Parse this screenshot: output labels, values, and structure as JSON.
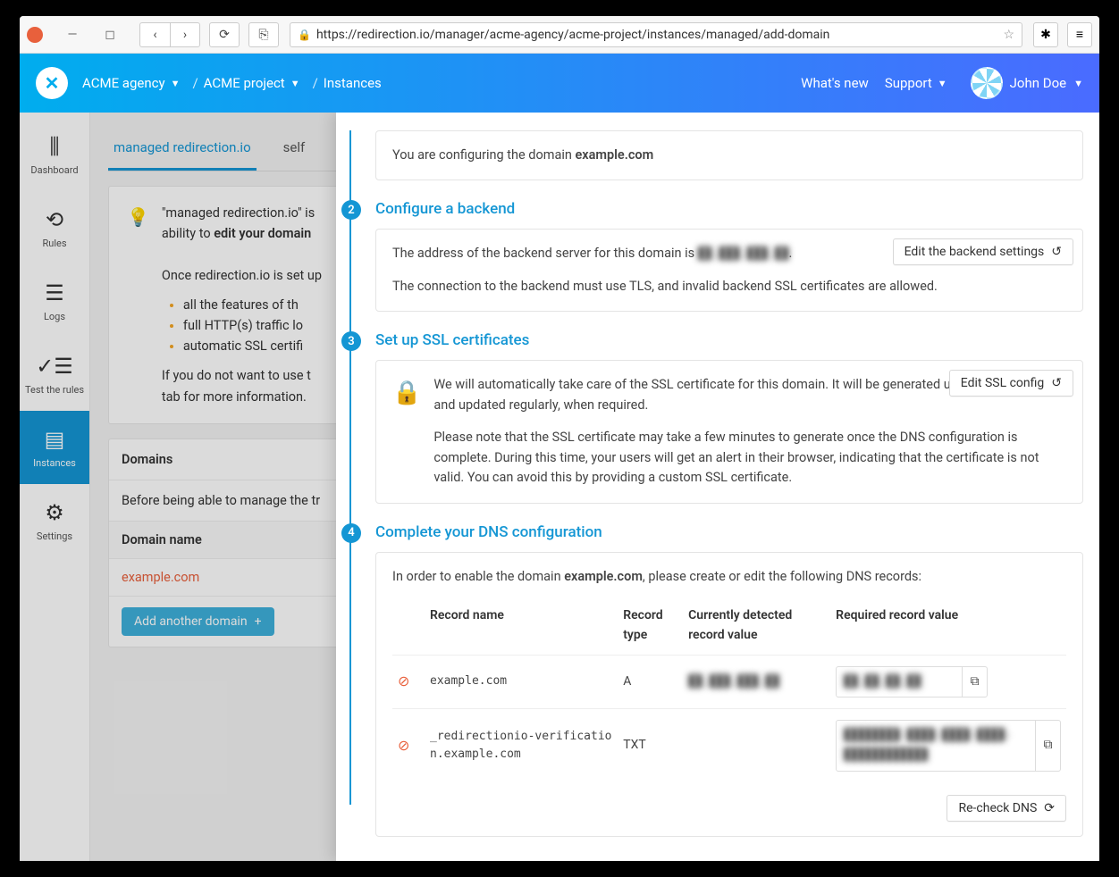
{
  "browser": {
    "url": "https://redirection.io/manager/acme-agency/acme-project/instances/managed/add-domain"
  },
  "breadcrumb": {
    "agency": "ACME agency",
    "project": "ACME project",
    "section": "Instances"
  },
  "header": {
    "whats_new": "What's new",
    "support": "Support",
    "user": "John Doe"
  },
  "sidebar": {
    "dashboard": "Dashboard",
    "rules": "Rules",
    "logs": "Logs",
    "test": "Test the rules",
    "instances": "Instances",
    "settings": "Settings"
  },
  "tabs": {
    "managed": "managed redirection.io",
    "self": "self"
  },
  "info": {
    "line1_a": "\"managed redirection.io\" is",
    "line1_b": "ability to ",
    "line1_c": "edit your domain",
    "line2": "Once redirection.io is set up",
    "b1": "all the features of th",
    "b2": "full HTTP(s) traffic lo",
    "b3": "automatic SSL certifi",
    "line3": "If you do not want to use t",
    "line4": "tab for more information."
  },
  "domains": {
    "title": "Domains",
    "note": "Before being able to manage the tr",
    "col": "Domain name",
    "row1": "example.com",
    "add": "Add another domain"
  },
  "panel": {
    "step1_prefix": "You are configuring the domain ",
    "step1_domain": "example.com",
    "step2_title": "Configure a backend",
    "step2_l1a": "The address of the backend server for this domain is ",
    "step2_l1b": "██.███.███.██",
    "step2_l2": "The connection to the backend must use TLS, and invalid backend SSL certificates are allowed.",
    "step2_btn": "Edit the backend settings",
    "step3_title": "Set up SSL certificates",
    "step3_p1": "We will automatically take care of the SSL certificate for this domain. It will be generated using Let's Encrypt and updated regularly, when required.",
    "step3_p2": "Please note that the SSL certificate may take a few minutes to generate once the DNS configuration is complete. During this time, your users will get an alert in their browser, indicating that the certificate is not valid. You can avoid this by providing a custom SSL certificate.",
    "step3_btn": "Edit SSL config",
    "step4_title": "Complete your DNS configuration",
    "step4_intro_a": "In order to enable the domain ",
    "step4_intro_b": "example.com",
    "step4_intro_c": ", please create or edit the following DNS records:",
    "dns_headers": {
      "name": "Record name",
      "type": "Record type",
      "current": "Currently detected record value",
      "required": "Required record value"
    },
    "dns_rows": [
      {
        "name": "example.com",
        "type": "A",
        "current": "██.███.███.██",
        "required": "██.██.██.██"
      },
      {
        "name": "_redirectionio-verification.example.com",
        "type": "TXT",
        "current": "",
        "required": "████████-████-████-████-████████████"
      }
    ],
    "recheck": "Re-check DNS"
  }
}
